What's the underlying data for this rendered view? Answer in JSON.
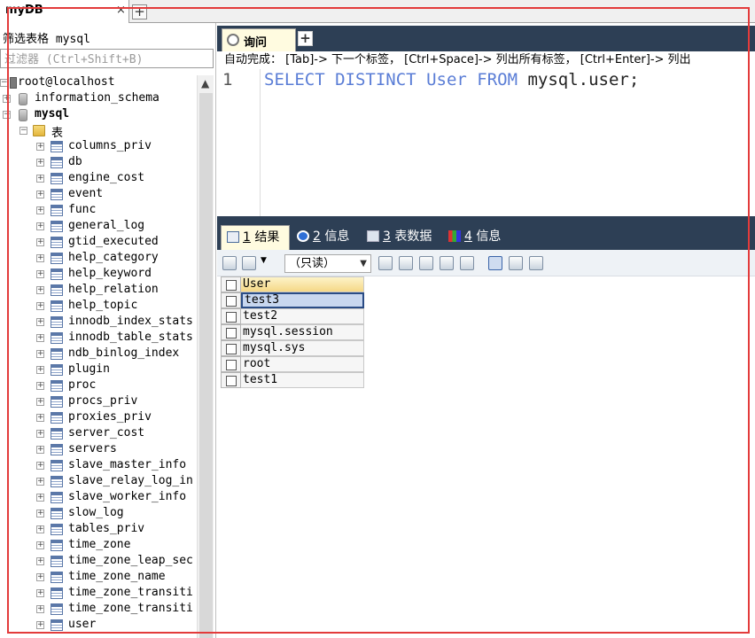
{
  "connection_tab": {
    "title": "myDB",
    "close": "×",
    "new": "+"
  },
  "filter": {
    "label": "筛选表格 mysql",
    "placeholder": "过滤器 (Ctrl+Shift+B)"
  },
  "tree": {
    "host": "root@localhost",
    "databases": [
      "information_schema",
      "mysql"
    ],
    "folder": "表",
    "tables": [
      "columns_priv",
      "db",
      "engine_cost",
      "event",
      "func",
      "general_log",
      "gtid_executed",
      "help_category",
      "help_keyword",
      "help_relation",
      "help_topic",
      "innodb_index_stats",
      "innodb_table_stats",
      "ndb_binlog_index",
      "plugin",
      "proc",
      "procs_priv",
      "proxies_priv",
      "server_cost",
      "servers",
      "slave_master_info",
      "slave_relay_log_in",
      "slave_worker_info",
      "slow_log",
      "tables_priv",
      "time_zone",
      "time_zone_leap_sec",
      "time_zone_name",
      "time_zone_transiti",
      "time_zone_transiti",
      "user"
    ]
  },
  "query_tab": {
    "label": "询问",
    "new": "+"
  },
  "hint": "自动完成：  [Tab]-> 下一个标签，  [Ctrl+Space]-> 列出所有标签，  [Ctrl+Enter]-> 列出",
  "editor": {
    "line_number": "1",
    "tokens": [
      {
        "t": "SELECT",
        "kw": true
      },
      {
        "t": " ",
        "kw": false
      },
      {
        "t": "DISTINCT",
        "kw": true
      },
      {
        "t": " ",
        "kw": false
      },
      {
        "t": "User",
        "kw": true
      },
      {
        "t": " ",
        "kw": false
      },
      {
        "t": "FROM",
        "kw": true
      },
      {
        "t": " mysql.user;",
        "kw": false
      }
    ]
  },
  "result_tabs": [
    {
      "num": "1",
      "label": "结果",
      "icon": "result-grid-icon",
      "active": true
    },
    {
      "num": "2",
      "label": "信息",
      "icon": "info-icon",
      "active": false
    },
    {
      "num": "3",
      "label": "表数据",
      "icon": "table-data-icon",
      "active": false
    },
    {
      "num": "4",
      "label": "信息",
      "icon": "info-chart-icon",
      "active": false
    }
  ],
  "result_toolbar": {
    "mode": "（只读）"
  },
  "result_grid": {
    "column": "User",
    "rows": [
      "test3",
      "test2",
      "mysql.session",
      "mysql.sys",
      "root",
      "test1"
    ],
    "selected_row": 0
  }
}
